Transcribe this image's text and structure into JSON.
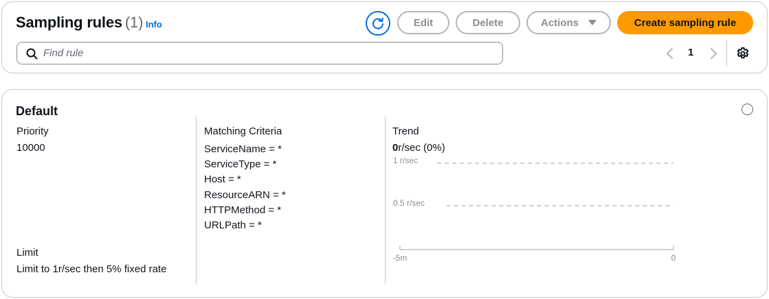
{
  "header": {
    "title": "Sampling rules",
    "count": "(1)",
    "info_label": "Info",
    "buttons": {
      "edit": "Edit",
      "delete": "Delete",
      "actions": "Actions",
      "create": "Create sampling rule"
    },
    "search": {
      "placeholder": "Find rule",
      "value": ""
    },
    "pagination": {
      "current_page": "1"
    }
  },
  "rule": {
    "name": "Default",
    "priority": {
      "label": "Priority",
      "value": "10000"
    },
    "limit": {
      "label": "Limit",
      "value": "Limit to 1r/sec then 5% fixed rate"
    },
    "matching": {
      "label": "Matching Criteria",
      "criteria": [
        "ServiceName = *",
        "ServiceType = *",
        "Host = *",
        "ResourceARN = *",
        "HTTPMethod = *",
        "URLPath = *"
      ]
    },
    "trend": {
      "label": "Trend",
      "rate_value": "0",
      "rate_suffix": "r/sec (0%)"
    }
  },
  "chart_data": {
    "type": "line",
    "y_ticks": [
      "1 r/sec",
      "0.5 r/sec"
    ],
    "x_ticks": [
      "-5m",
      "0"
    ],
    "ylim": [
      0,
      1
    ],
    "series": [],
    "grid": true
  },
  "colors": {
    "primary_button": "#ff9900",
    "link": "#006ce0",
    "disabled_text": "#8c8c94",
    "border": "#c6c6cd"
  }
}
